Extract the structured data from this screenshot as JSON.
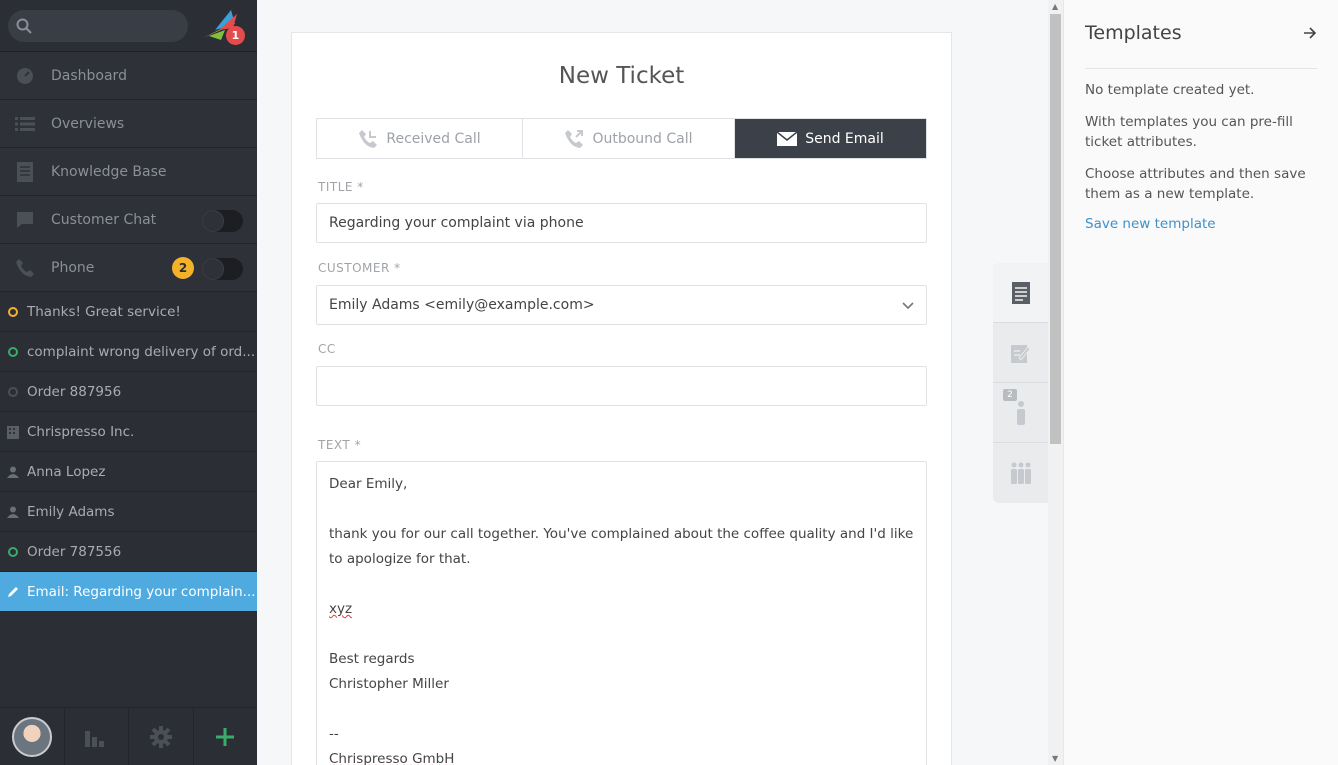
{
  "sidebar": {
    "notification_count": "1",
    "nav": [
      {
        "label": "Dashboard",
        "icon": "dashboard-icon"
      },
      {
        "label": "Overviews",
        "icon": "list-icon"
      },
      {
        "label": "Knowledge Base",
        "icon": "book-icon"
      },
      {
        "label": "Customer Chat",
        "icon": "chat-icon"
      },
      {
        "label": "Phone",
        "icon": "phone-icon",
        "badge": "2"
      }
    ],
    "tasks": [
      {
        "label": "Thanks! Great service!",
        "kind": "ticket-open"
      },
      {
        "label": "complaint wrong delivery of ord...",
        "kind": "ticket-new"
      },
      {
        "label": "Order 887956",
        "kind": "ticket-closed"
      },
      {
        "label": "Chrispresso Inc.",
        "kind": "organization"
      },
      {
        "label": "Anna Lopez",
        "kind": "user"
      },
      {
        "label": "Emily Adams",
        "kind": "user"
      },
      {
        "label": "Order 787556",
        "kind": "ticket-new"
      },
      {
        "label": "Email: Regarding your complain...",
        "kind": "draft"
      }
    ]
  },
  "ticket": {
    "heading": "New Ticket",
    "tabs": [
      "Received Call",
      "Outbound Call",
      "Send Email"
    ],
    "active_tab": "Send Email",
    "title_label": "TITLE *",
    "title_value": "Regarding your complaint via phone",
    "customer_label": "CUSTOMER *",
    "customer_value": "Emily Adams <emily@example.com>",
    "cc_label": "CC",
    "cc_value": "",
    "text_label": "TEXT *",
    "body": {
      "line1": "Dear Emily,",
      "line2": "thank you for our call together. You've complained about the coffee quality and I'd like to apologize for that.",
      "line3": "xyz",
      "line4": "Best regards",
      "line5": "Christopher Miller",
      "line6": "--",
      "line7": "Chrispresso GmbH"
    }
  },
  "templates": {
    "title": "Templates",
    "empty": "No template created yet.",
    "info1": "With templates you can pre-fill ticket attributes.",
    "info2": "Choose attributes and then save them as a new template.",
    "save_link": "Save new template"
  },
  "colors": {
    "accent": "#4faae0",
    "sidebar": "#2b2e35",
    "badge_red": "#e54b4b",
    "badge_yellow": "#f4b22a"
  }
}
